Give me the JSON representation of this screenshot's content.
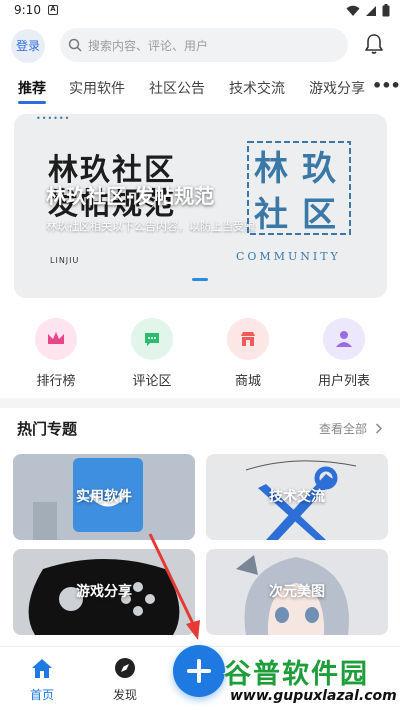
{
  "status_bar": {
    "time": "9:10",
    "notification_badge": "A"
  },
  "header": {
    "login_label": "登录",
    "search_placeholder": "搜索内容、评论、用户"
  },
  "tabs": [
    {
      "label": "推荐",
      "active": true
    },
    {
      "label": "实用软件",
      "active": false
    },
    {
      "label": "社区公告",
      "active": false
    },
    {
      "label": "技术交流",
      "active": false
    },
    {
      "label": "游戏分享",
      "active": false
    }
  ],
  "banner": {
    "brand_title_line1": "林玖社区",
    "brand_title_line2": "发帖规范",
    "overlay_title": "林玖社区-发帖规范",
    "overlay_subtitle": "林玖社区相关以下公告内容，以防上当受骗",
    "small_brand": "LINJIU",
    "logo_chars": [
      "林",
      "玖",
      "社",
      "区"
    ],
    "logo_caption": "COMMUNITY"
  },
  "quick_links": [
    {
      "label": "排行榜",
      "icon": "crown-icon",
      "bg": "#fde4ef",
      "fg": "#e8468a"
    },
    {
      "label": "评论区",
      "icon": "comment-icon",
      "bg": "#e1f5ea",
      "fg": "#2dbb6d"
    },
    {
      "label": "商城",
      "icon": "store-icon",
      "bg": "#fde6e6",
      "fg": "#ef5b5b"
    },
    {
      "label": "用户列表",
      "icon": "user-icon",
      "bg": "#ece7fb",
      "fg": "#9b6be6"
    }
  ],
  "hot_topics": {
    "title": "热门专题",
    "see_all": "查看全部",
    "items": [
      {
        "label": "实用软件",
        "bg": "#b9c2cc"
      },
      {
        "label": "技术交流",
        "bg": "#e7e8ea"
      },
      {
        "label": "游戏分享",
        "bg": "#cdd0d4"
      },
      {
        "label": "次元美图",
        "bg": "#e2e4e8"
      }
    ]
  },
  "bottom_nav": {
    "items": [
      {
        "label": "首页",
        "icon": "home-icon",
        "active": true
      },
      {
        "label": "发现",
        "icon": "compass-icon",
        "active": false
      }
    ],
    "fab_icon": "plus-icon"
  },
  "watermark": {
    "name": "谷普软件园",
    "url": "www.gupuxlazal.com"
  },
  "colors": {
    "accent": "#1e7ae0",
    "watermark_green": "#1e9e3a",
    "arrow_red": "#e53935"
  }
}
